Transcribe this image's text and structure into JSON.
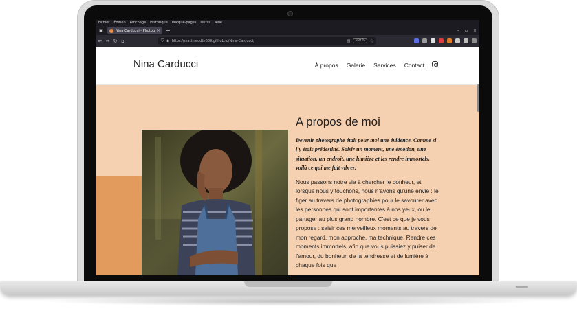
{
  "browser": {
    "menu": [
      "Fichier",
      "Édition",
      "Affichage",
      "Historique",
      "Marque-pages",
      "Outils",
      "Aide"
    ],
    "tab_title": "Nina Carducci - Photographe",
    "tab_close": "×",
    "new_tab": "+",
    "url": "https://matthieudth689.github.io/Nina-Carducci/",
    "zoom": "150 %",
    "window_controls": [
      "–",
      "▫",
      "×"
    ]
  },
  "site": {
    "name": "Nina Carducci",
    "nav": [
      "À propos",
      "Galerie",
      "Services",
      "Contact"
    ],
    "about": {
      "title": "A propos de moi",
      "quote": "Devenir photographe était pour moi une évidence. Comme si j'y étais prédestiné. Saisir un moment, une émotion, une situation, un endroit, une lumière et les rendre immortels, voilà ce qui me fait vibrer.",
      "body": "Nous passons notre vie à chercher le bonheur, et lorsque nous y touchons, nous n'avons qu'une envie : le figer au travers de photographies pour le savourer avec les personnes qui sont importantes à nos yeux, ou le partager au plus grand nombre. C'est ce que je vous propose : saisir ces merveilleux moments au travers de mon regard, mon approche, ma technique. Rendre ces moments immortels, afin que vous puissiez y puiser de l'amour, du bonheur, de la tendresse et de lumière à chaque fois que"
    }
  },
  "colors": {
    "page_bg": "#f6d1b1",
    "accent": "#e39a5d",
    "browser_dark": "#1c1b22"
  }
}
